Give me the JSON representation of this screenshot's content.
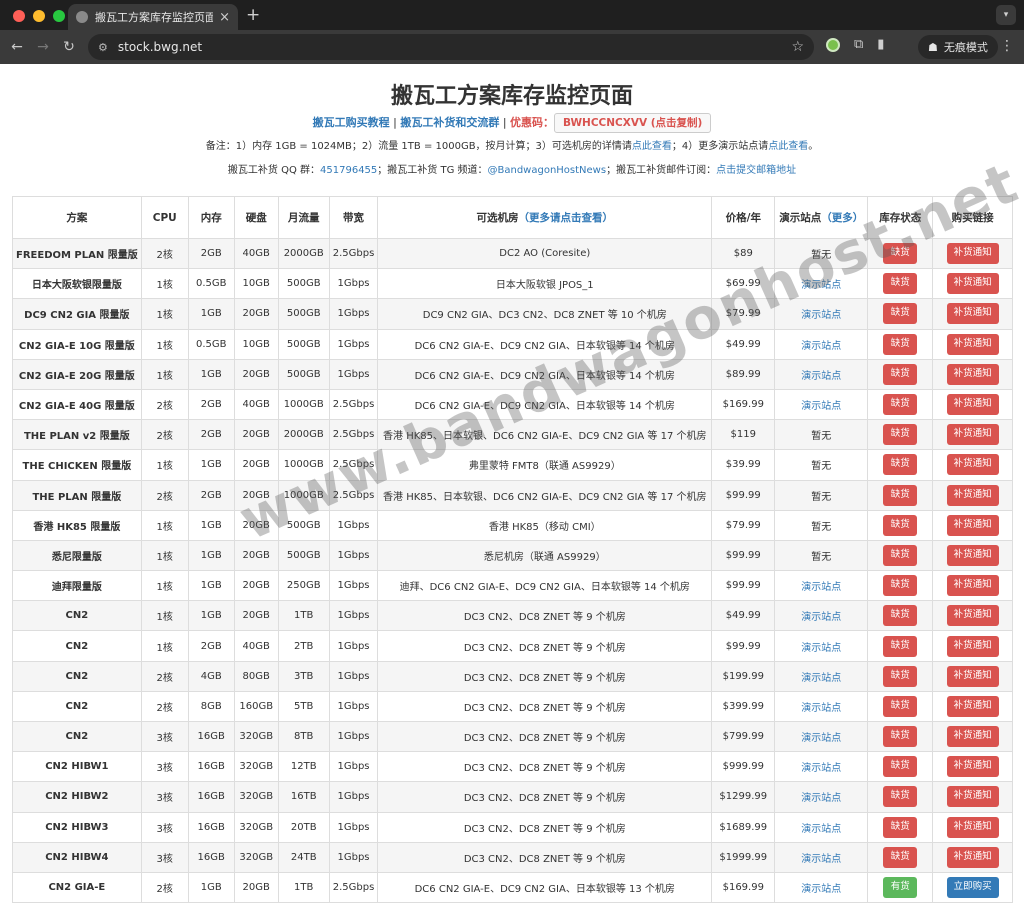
{
  "browser": {
    "tab_title": "搬瓦工方案库存监控页面 - 搬瓦",
    "url": "stock.bwg.net",
    "incognito_label": "无痕模式"
  },
  "page": {
    "title": "搬瓦工方案库存监控页面",
    "links": {
      "tutorial": "搬瓦工购买教程",
      "sep1": " | ",
      "group": "搬瓦工补货和交流群",
      "sep2": " | ",
      "coupon_label": "优惠码：",
      "coupon_button": "BWHCCNCXVV (点击复制)"
    },
    "note": {
      "part1": "备注：1）内存 1GB = 1024MB；2）流量 1TB = 1000GB，按月计算；3）可选机房的详情请",
      "link1": "点此查看",
      "part2": "；4）更多演示站点请",
      "link2": "点此查看",
      "part3": "。"
    },
    "contact": {
      "qq_label": "搬瓦工补货 QQ 群：",
      "qq_value": "451796455",
      "tg_label": "；搬瓦工补货 TG 频道：",
      "tg_value": "@BandwagonHostNews",
      "mail_label": "；搬瓦工补货邮件订阅：",
      "mail_value": "点击提交邮箱地址"
    },
    "watermark": "www.bandwagonhost.net"
  },
  "table": {
    "headers": {
      "plan": "方案",
      "cpu": "CPU",
      "ram": "内存",
      "disk": "硬盘",
      "traffic": "月流量",
      "bandwidth": "带宽",
      "dc": "可选机房",
      "dc_more": "（更多请点击查看）",
      "price": "价格/年",
      "demo": "演示站点",
      "demo_more": "（更多）",
      "status": "库存状态",
      "buy": "购买链接"
    },
    "rows": [
      {
        "plan": "FREEDOM PLAN 限量版",
        "cpu": "2核",
        "ram": "2GB",
        "disk": "40GB",
        "traffic": "2000GB",
        "bw": "2.5Gbps",
        "dc": "DC2 AO (Coresite)",
        "price": "$89",
        "demo": "暂无",
        "status": "缺货",
        "buy": "补货通知"
      },
      {
        "plan": "日本大阪软银限量版",
        "cpu": "1核",
        "ram": "0.5GB",
        "disk": "10GB",
        "traffic": "500GB",
        "bw": "1Gbps",
        "dc": "日本大阪软银 JPOS_1",
        "price": "$69.99",
        "demo": "演示站点",
        "status": "缺货",
        "buy": "补货通知"
      },
      {
        "plan": "DC9 CN2 GIA 限量版",
        "cpu": "1核",
        "ram": "1GB",
        "disk": "20GB",
        "traffic": "500GB",
        "bw": "1Gbps",
        "dc": "DC9 CN2 GIA、DC3 CN2、DC8 ZNET 等 10 个机房",
        "price": "$79.99",
        "demo": "演示站点",
        "status": "缺货",
        "buy": "补货通知"
      },
      {
        "plan": "CN2 GIA-E 10G 限量版",
        "cpu": "1核",
        "ram": "0.5GB",
        "disk": "10GB",
        "traffic": "500GB",
        "bw": "1Gbps",
        "dc": "DC6 CN2 GIA-E、DC9 CN2 GIA、日本软银等 14 个机房",
        "price": "$49.99",
        "demo": "演示站点",
        "status": "缺货",
        "buy": "补货通知"
      },
      {
        "plan": "CN2 GIA-E 20G 限量版",
        "cpu": "1核",
        "ram": "1GB",
        "disk": "20GB",
        "traffic": "500GB",
        "bw": "1Gbps",
        "dc": "DC6 CN2 GIA-E、DC9 CN2 GIA、日本软银等 14 个机房",
        "price": "$89.99",
        "demo": "演示站点",
        "status": "缺货",
        "buy": "补货通知"
      },
      {
        "plan": "CN2 GIA-E 40G 限量版",
        "cpu": "2核",
        "ram": "2GB",
        "disk": "40GB",
        "traffic": "1000GB",
        "bw": "2.5Gbps",
        "dc": "DC6 CN2 GIA-E、DC9 CN2 GIA、日本软银等 14 个机房",
        "price": "$169.99",
        "demo": "演示站点",
        "status": "缺货",
        "buy": "补货通知"
      },
      {
        "plan": "THE PLAN v2 限量版",
        "cpu": "2核",
        "ram": "2GB",
        "disk": "20GB",
        "traffic": "2000GB",
        "bw": "2.5Gbps",
        "dc": "香港 HK85、日本软银、DC6 CN2 GIA-E、DC9 CN2 GIA 等 17 个机房",
        "price": "$119",
        "demo": "暂无",
        "status": "缺货",
        "buy": "补货通知"
      },
      {
        "plan": "THE CHICKEN 限量版",
        "cpu": "1核",
        "ram": "1GB",
        "disk": "20GB",
        "traffic": "1000GB",
        "bw": "2.5Gbps",
        "dc": "弗里蒙特 FMT8（联通 AS9929）",
        "price": "$39.99",
        "demo": "暂无",
        "status": "缺货",
        "buy": "补货通知"
      },
      {
        "plan": "THE PLAN 限量版",
        "cpu": "2核",
        "ram": "2GB",
        "disk": "20GB",
        "traffic": "1000GB",
        "bw": "2.5Gbps",
        "dc": "香港 HK85、日本软银、DC6 CN2 GIA-E、DC9 CN2 GIA 等 17 个机房",
        "price": "$99.99",
        "demo": "暂无",
        "status": "缺货",
        "buy": "补货通知"
      },
      {
        "plan": "香港 HK85 限量版",
        "cpu": "1核",
        "ram": "1GB",
        "disk": "20GB",
        "traffic": "500GB",
        "bw": "1Gbps",
        "dc": "香港 HK85（移动 CMI）",
        "price": "$79.99",
        "demo": "暂无",
        "status": "缺货",
        "buy": "补货通知"
      },
      {
        "plan": "悉尼限量版",
        "cpu": "1核",
        "ram": "1GB",
        "disk": "20GB",
        "traffic": "500GB",
        "bw": "1Gbps",
        "dc": "悉尼机房（联通 AS9929）",
        "price": "$99.99",
        "demo": "暂无",
        "status": "缺货",
        "buy": "补货通知"
      },
      {
        "plan": "迪拜限量版",
        "cpu": "1核",
        "ram": "1GB",
        "disk": "20GB",
        "traffic": "250GB",
        "bw": "1Gbps",
        "dc": "迪拜、DC6 CN2 GIA-E、DC9 CN2 GIA、日本软银等 14 个机房",
        "price": "$99.99",
        "demo": "演示站点",
        "status": "缺货",
        "buy": "补货通知"
      },
      {
        "plan": "CN2",
        "cpu": "1核",
        "ram": "1GB",
        "disk": "20GB",
        "traffic": "1TB",
        "bw": "1Gbps",
        "dc": "DC3 CN2、DC8 ZNET 等 9 个机房",
        "price": "$49.99",
        "demo": "演示站点",
        "status": "缺货",
        "buy": "补货通知"
      },
      {
        "plan": "CN2",
        "cpu": "1核",
        "ram": "2GB",
        "disk": "40GB",
        "traffic": "2TB",
        "bw": "1Gbps",
        "dc": "DC3 CN2、DC8 ZNET 等 9 个机房",
        "price": "$99.99",
        "demo": "演示站点",
        "status": "缺货",
        "buy": "补货通知"
      },
      {
        "plan": "CN2",
        "cpu": "2核",
        "ram": "4GB",
        "disk": "80GB",
        "traffic": "3TB",
        "bw": "1Gbps",
        "dc": "DC3 CN2、DC8 ZNET 等 9 个机房",
        "price": "$199.99",
        "demo": "演示站点",
        "status": "缺货",
        "buy": "补货通知"
      },
      {
        "plan": "CN2",
        "cpu": "2核",
        "ram": "8GB",
        "disk": "160GB",
        "traffic": "5TB",
        "bw": "1Gbps",
        "dc": "DC3 CN2、DC8 ZNET 等 9 个机房",
        "price": "$399.99",
        "demo": "演示站点",
        "status": "缺货",
        "buy": "补货通知"
      },
      {
        "plan": "CN2",
        "cpu": "3核",
        "ram": "16GB",
        "disk": "320GB",
        "traffic": "8TB",
        "bw": "1Gbps",
        "dc": "DC3 CN2、DC8 ZNET 等 9 个机房",
        "price": "$799.99",
        "demo": "演示站点",
        "status": "缺货",
        "buy": "补货通知"
      },
      {
        "plan": "CN2 HIBW1",
        "cpu": "3核",
        "ram": "16GB",
        "disk": "320GB",
        "traffic": "12TB",
        "bw": "1Gbps",
        "dc": "DC3 CN2、DC8 ZNET 等 9 个机房",
        "price": "$999.99",
        "demo": "演示站点",
        "status": "缺货",
        "buy": "补货通知"
      },
      {
        "plan": "CN2 HIBW2",
        "cpu": "3核",
        "ram": "16GB",
        "disk": "320GB",
        "traffic": "16TB",
        "bw": "1Gbps",
        "dc": "DC3 CN2、DC8 ZNET 等 9 个机房",
        "price": "$1299.99",
        "demo": "演示站点",
        "status": "缺货",
        "buy": "补货通知"
      },
      {
        "plan": "CN2 HIBW3",
        "cpu": "3核",
        "ram": "16GB",
        "disk": "320GB",
        "traffic": "20TB",
        "bw": "1Gbps",
        "dc": "DC3 CN2、DC8 ZNET 等 9 个机房",
        "price": "$1689.99",
        "demo": "演示站点",
        "status": "缺货",
        "buy": "补货通知"
      },
      {
        "plan": "CN2 HIBW4",
        "cpu": "3核",
        "ram": "16GB",
        "disk": "320GB",
        "traffic": "24TB",
        "bw": "1Gbps",
        "dc": "DC3 CN2、DC8 ZNET 等 9 个机房",
        "price": "$1999.99",
        "demo": "演示站点",
        "status": "缺货",
        "buy": "补货通知"
      },
      {
        "plan": "CN2 GIA-E",
        "cpu": "2核",
        "ram": "1GB",
        "disk": "20GB",
        "traffic": "1TB",
        "bw": "2.5Gbps",
        "dc": "DC6 CN2 GIA-E、DC9 CN2 GIA、日本软银等 13 个机房",
        "price": "$169.99",
        "demo": "演示站点",
        "status": "有货",
        "buy": "立即购买"
      }
    ]
  },
  "colors": {
    "out_of_stock": "#d9534f",
    "in_stock": "#5cb85c",
    "buy_now": "#337ab7",
    "link": "#337ab7"
  }
}
